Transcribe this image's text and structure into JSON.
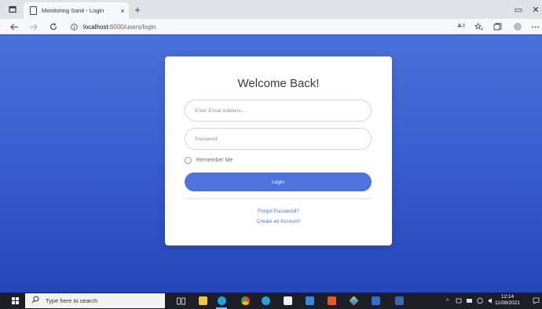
{
  "browser": {
    "tab_title": "Monitoring Sanit - Login",
    "tab_close": "×",
    "new_tab": "+",
    "url_host": "localhost",
    "url_path": ":6000/users/login",
    "window_controls": {
      "restore": "▭",
      "close": "✕"
    },
    "icons": [
      "tab-actions-icon",
      "page-icon",
      "back-icon",
      "forward-icon",
      "refresh-icon",
      "info-icon",
      "read-aloud-icon",
      "favorites-icon",
      "collections-icon",
      "profile-icon",
      "more-icon"
    ]
  },
  "login": {
    "title": "Welcome Back!",
    "email_placeholder": "Enter Email Address...",
    "password_placeholder": "Password",
    "remember_label": "Remember Me",
    "login_label": "Login",
    "forgot_label": "Forgot Password?",
    "create_label": "Create an Account!"
  },
  "taskbar": {
    "search_placeholder": "Type here to search",
    "time": "12:14",
    "date": "11/08/2021",
    "apps": [
      "task-view",
      "file-explorer",
      "edge",
      "chrome",
      "telegram",
      "store",
      "vscode",
      "office",
      "git",
      "windows-terminal",
      "word"
    ]
  },
  "colors": {
    "accent": "#4e73df",
    "page_bg_top": "#4a70d9",
    "page_bg_bottom": "#2546b8",
    "taskbar": "#1c1f26"
  }
}
